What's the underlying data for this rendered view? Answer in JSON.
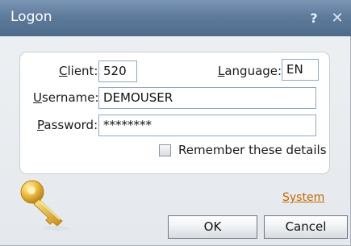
{
  "window": {
    "title": "Logon",
    "help_icon": "question-mark-icon",
    "close_icon": "x-close-icon"
  },
  "form": {
    "client": {
      "label_first": "C",
      "label_rest": "lient:",
      "value": "520"
    },
    "language": {
      "label_first": "L",
      "label_rest": "anguage:",
      "value": "EN"
    },
    "username": {
      "label_first": "U",
      "label_rest": "sername:",
      "value": "DEMOUSER"
    },
    "password": {
      "label_first": "P",
      "label_rest": "assword:",
      "value": "********"
    },
    "remember": {
      "label": "Remember these details",
      "checked": false
    }
  },
  "footer": {
    "system_link": "System",
    "ok_label": "OK",
    "cancel_label": "Cancel",
    "key_icon": "key-icon"
  },
  "colors": {
    "titlebar": "#5f7b9c",
    "link": "#c36900",
    "input_border": "#90a8c5"
  }
}
